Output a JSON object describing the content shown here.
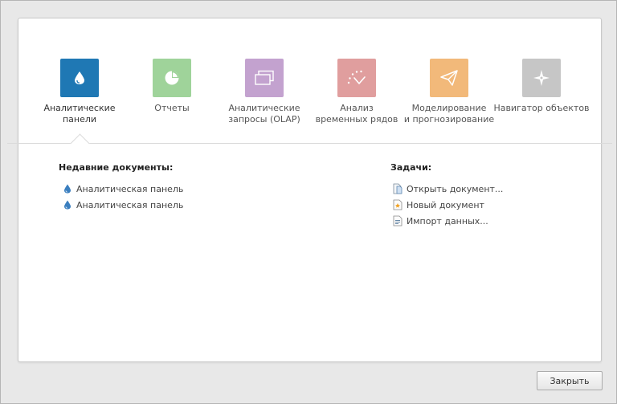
{
  "colors": {
    "analytic_panels": "#1f78b4",
    "reports": "#9fd39a",
    "olap": "#c3a2cf",
    "time_series": "#e09e9e",
    "modeling": "#f2b97a",
    "navigator": "#c6c6c6"
  },
  "tiles": [
    {
      "label": "Аналитические\nпанели",
      "icon": "drop-icon"
    },
    {
      "label": "Отчеты",
      "icon": "pie-chart-icon"
    },
    {
      "label": "Аналитические\nзапросы (OLAP)",
      "icon": "cards-icon"
    },
    {
      "label": "Анализ\nвременных рядов",
      "icon": "time-series-icon"
    },
    {
      "label": "Моделирование\nи прогнозирование",
      "icon": "paper-plane-icon"
    },
    {
      "label": "Навигатор объектов",
      "icon": "compass-star-icon"
    }
  ],
  "recent": {
    "title": "Недавние документы:",
    "items": [
      {
        "label": "Аналитическая панель",
        "icon": "drop-icon"
      },
      {
        "label": "Аналитическая панель",
        "icon": "drop-icon"
      }
    ]
  },
  "tasks": {
    "title": "Задачи:",
    "items": [
      {
        "label": "Открыть документ...",
        "icon": "open-document-icon"
      },
      {
        "label": "Новый документ",
        "icon": "new-document-icon"
      },
      {
        "label": "Импорт данных...",
        "icon": "import-data-icon"
      }
    ]
  },
  "footer": {
    "close_label": "Закрыть"
  }
}
